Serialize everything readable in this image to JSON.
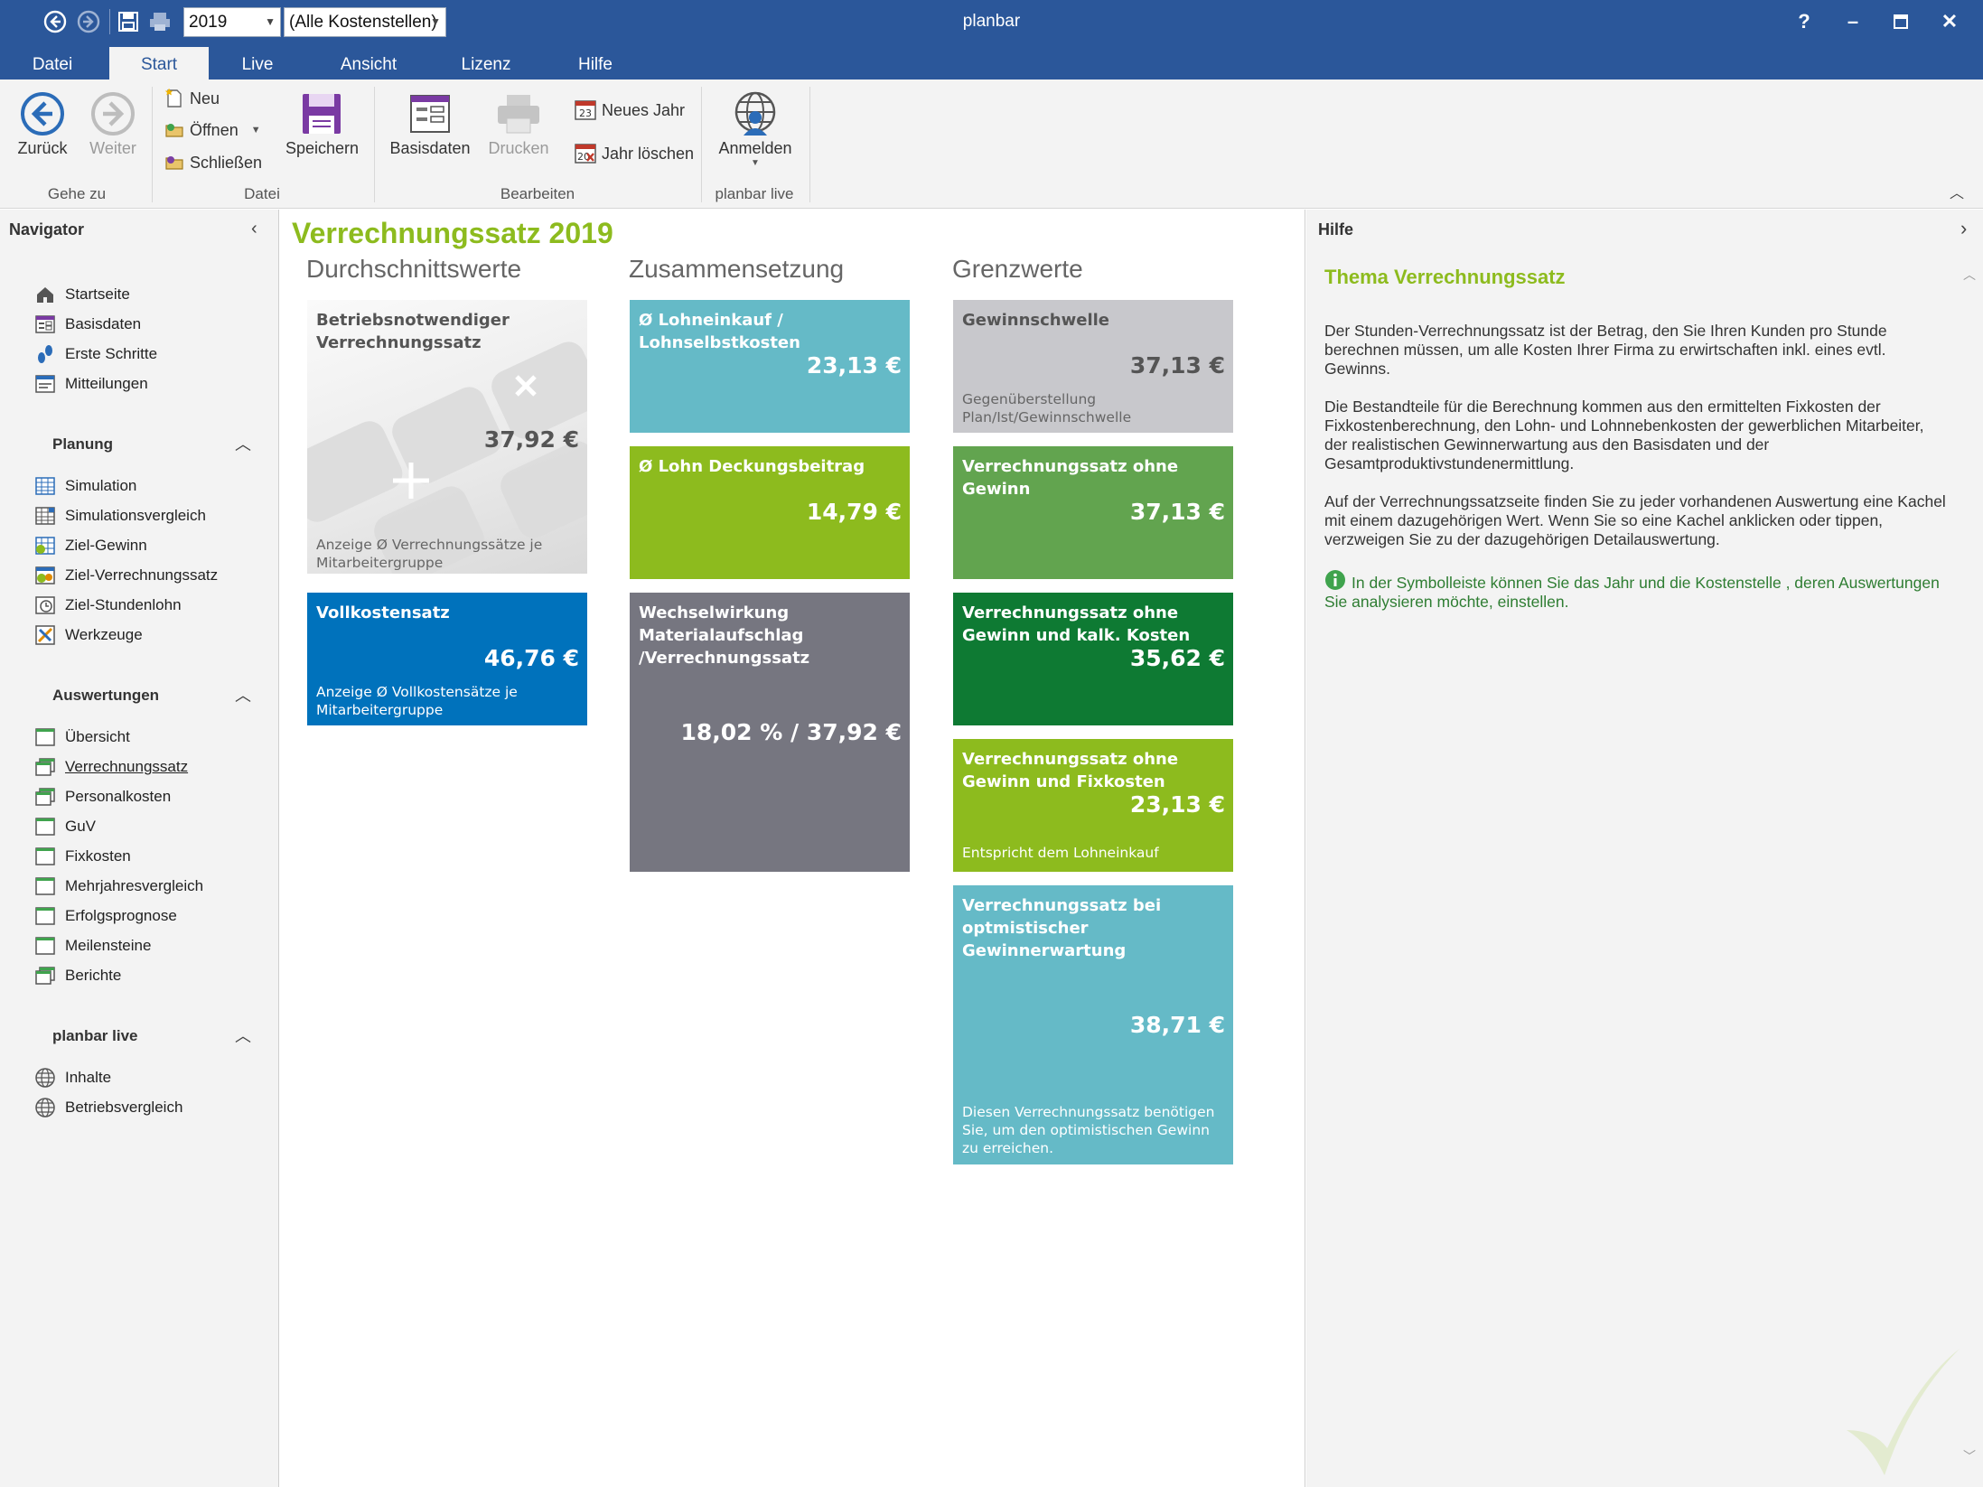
{
  "window": {
    "title": "planbar"
  },
  "quickaccess": {
    "year": "2019",
    "cost_center": "(Alle Kostenstellen)"
  },
  "tabs": [
    "Datei",
    "Start",
    "Live",
    "Ansicht",
    "Lizenz",
    "Hilfe"
  ],
  "ribbon": {
    "back": "Zurück",
    "forward": "Weiter",
    "new": "Neu",
    "open": "Öffnen",
    "close": "Schließen",
    "save": "Speichern",
    "basedata": "Basisdaten",
    "print": "Drucken",
    "new_year": "Neues Jahr",
    "delete_year": "Jahr löschen",
    "login": "Anmelden",
    "groups": [
      "Gehe zu",
      "Datei",
      "Bearbeiten",
      "planbar live"
    ]
  },
  "navigator": {
    "header": "Navigator",
    "top_items": [
      "Startseite",
      "Basisdaten",
      "Erste Schritte",
      "Mitteilungen"
    ],
    "planung": {
      "title": "Planung",
      "items": [
        "Simulation",
        "Simulationsvergleich",
        "Ziel-Gewinn",
        "Ziel-Verrechnungssatz",
        "Ziel-Stundenlohn",
        "Werkzeuge"
      ]
    },
    "auswertungen": {
      "title": "Auswertungen",
      "items": [
        "Übersicht",
        "Verrechnungssatz",
        "Personalkosten",
        "GuV",
        "Fixkosten",
        "Mehrjahresvergleich",
        "Erfolgsprognose",
        "Meilensteine",
        "Berichte"
      ]
    },
    "live": {
      "title": "planbar live",
      "items": [
        "Inhalte",
        "Betriebsvergleich"
      ]
    }
  },
  "main": {
    "title": "Verrechnungssatz 2019",
    "columns": [
      "Durchschnittswerte",
      "Zusammensetzung",
      "Grenzwerte"
    ],
    "tiles": {
      "betrieb": {
        "title": "Betriebsnotwendiger Verrechnungssatz",
        "value": "37,92 €",
        "sub": "Anzeige Ø Verrechnungssätze je Mitarbeitergruppe"
      },
      "vollkosten": {
        "title": "Vollkostensatz",
        "value": "46,76 €",
        "sub": "Anzeige Ø Vollkostensätze je Mitarbeitergruppe"
      },
      "lohneinkauf": {
        "title": "Ø Lohneinkauf / Lohnselbstkosten",
        "value": "23,13 €"
      },
      "deckung": {
        "title": "Ø Lohn Deckungsbeitrag",
        "value": "14,79 €"
      },
      "wechsel": {
        "title": "Wechselwirkung Materialaufschlag /Verrechnungssatz",
        "value": "18,02 % / 37,92 €"
      },
      "gewinnschwelle": {
        "title": "Gewinnschwelle",
        "value": "37,13 €",
        "sub": "Gegenüberstellung Plan/Ist/Gewinnschwelle"
      },
      "ohne_gewinn": {
        "title": "Verrechnungssatz ohne Gewinn",
        "value": "37,13 €"
      },
      "ohne_gewinn_kalk": {
        "title": "Verrechnungssatz ohne Gewinn und kalk. Kosten",
        "value": "35,62 €"
      },
      "ohne_gewinn_fix": {
        "title": "Verrechnungssatz ohne Gewinn und Fixkosten",
        "value": "23,13 €",
        "sub": "Entspricht dem Lohneinkauf"
      },
      "optimistisch": {
        "title": "Verrechnungssatz bei optmistischer Gewinnerwartung",
        "value": "38,71 €",
        "sub": "Diesen Verrechnungssatz benötigen Sie, um den optimistischen Gewinn zu erreichen."
      }
    }
  },
  "help": {
    "header": "Hilfe",
    "topic": "Thema Verrechnungssatz",
    "p1": "Der Stunden-Verrechnungssatz ist der Betrag, den Sie Ihren Kunden pro Stunde berechnen müssen, um alle Kosten Ihrer Firma zu erwirtschaften inkl. eines evtl. Gewinns.",
    "p2": "Die Bestandteile für die Berechnung kommen aus den ermittelten Fixkosten der Fixkostenberechnung, den Lohn- und Lohnnebenkosten der gewerblichen Mitarbeiter, der realistischen Gewinnerwartung aus den Basisdaten und der Gesamtproduktivstundenermittlung.",
    "p3": "Auf der Verrechnungssatzseite finden Sie zu jeder vorhandenen Auswertung eine Kachel mit einem dazugehörigen Wert. Wenn Sie so eine Kachel anklicken oder tippen, verzweigen Sie zu der dazugehörigen Detailauswertung.",
    "tip": "In der Symbolleiste können Sie das Jahr und die Kostenstelle , deren Auswertungen Sie analysieren möchte, einstellen."
  },
  "colors": {
    "accent_green": "#8dbb1e",
    "title_blue": "#2b579a",
    "tile_blue": "#0072bc",
    "tile_teal": "#65bac7",
    "tile_grey": "#767680",
    "tile_dark_green": "#0e7a33",
    "tile_mid_green": "#62a44f",
    "tile_light_grey": "#c8c8cc"
  }
}
